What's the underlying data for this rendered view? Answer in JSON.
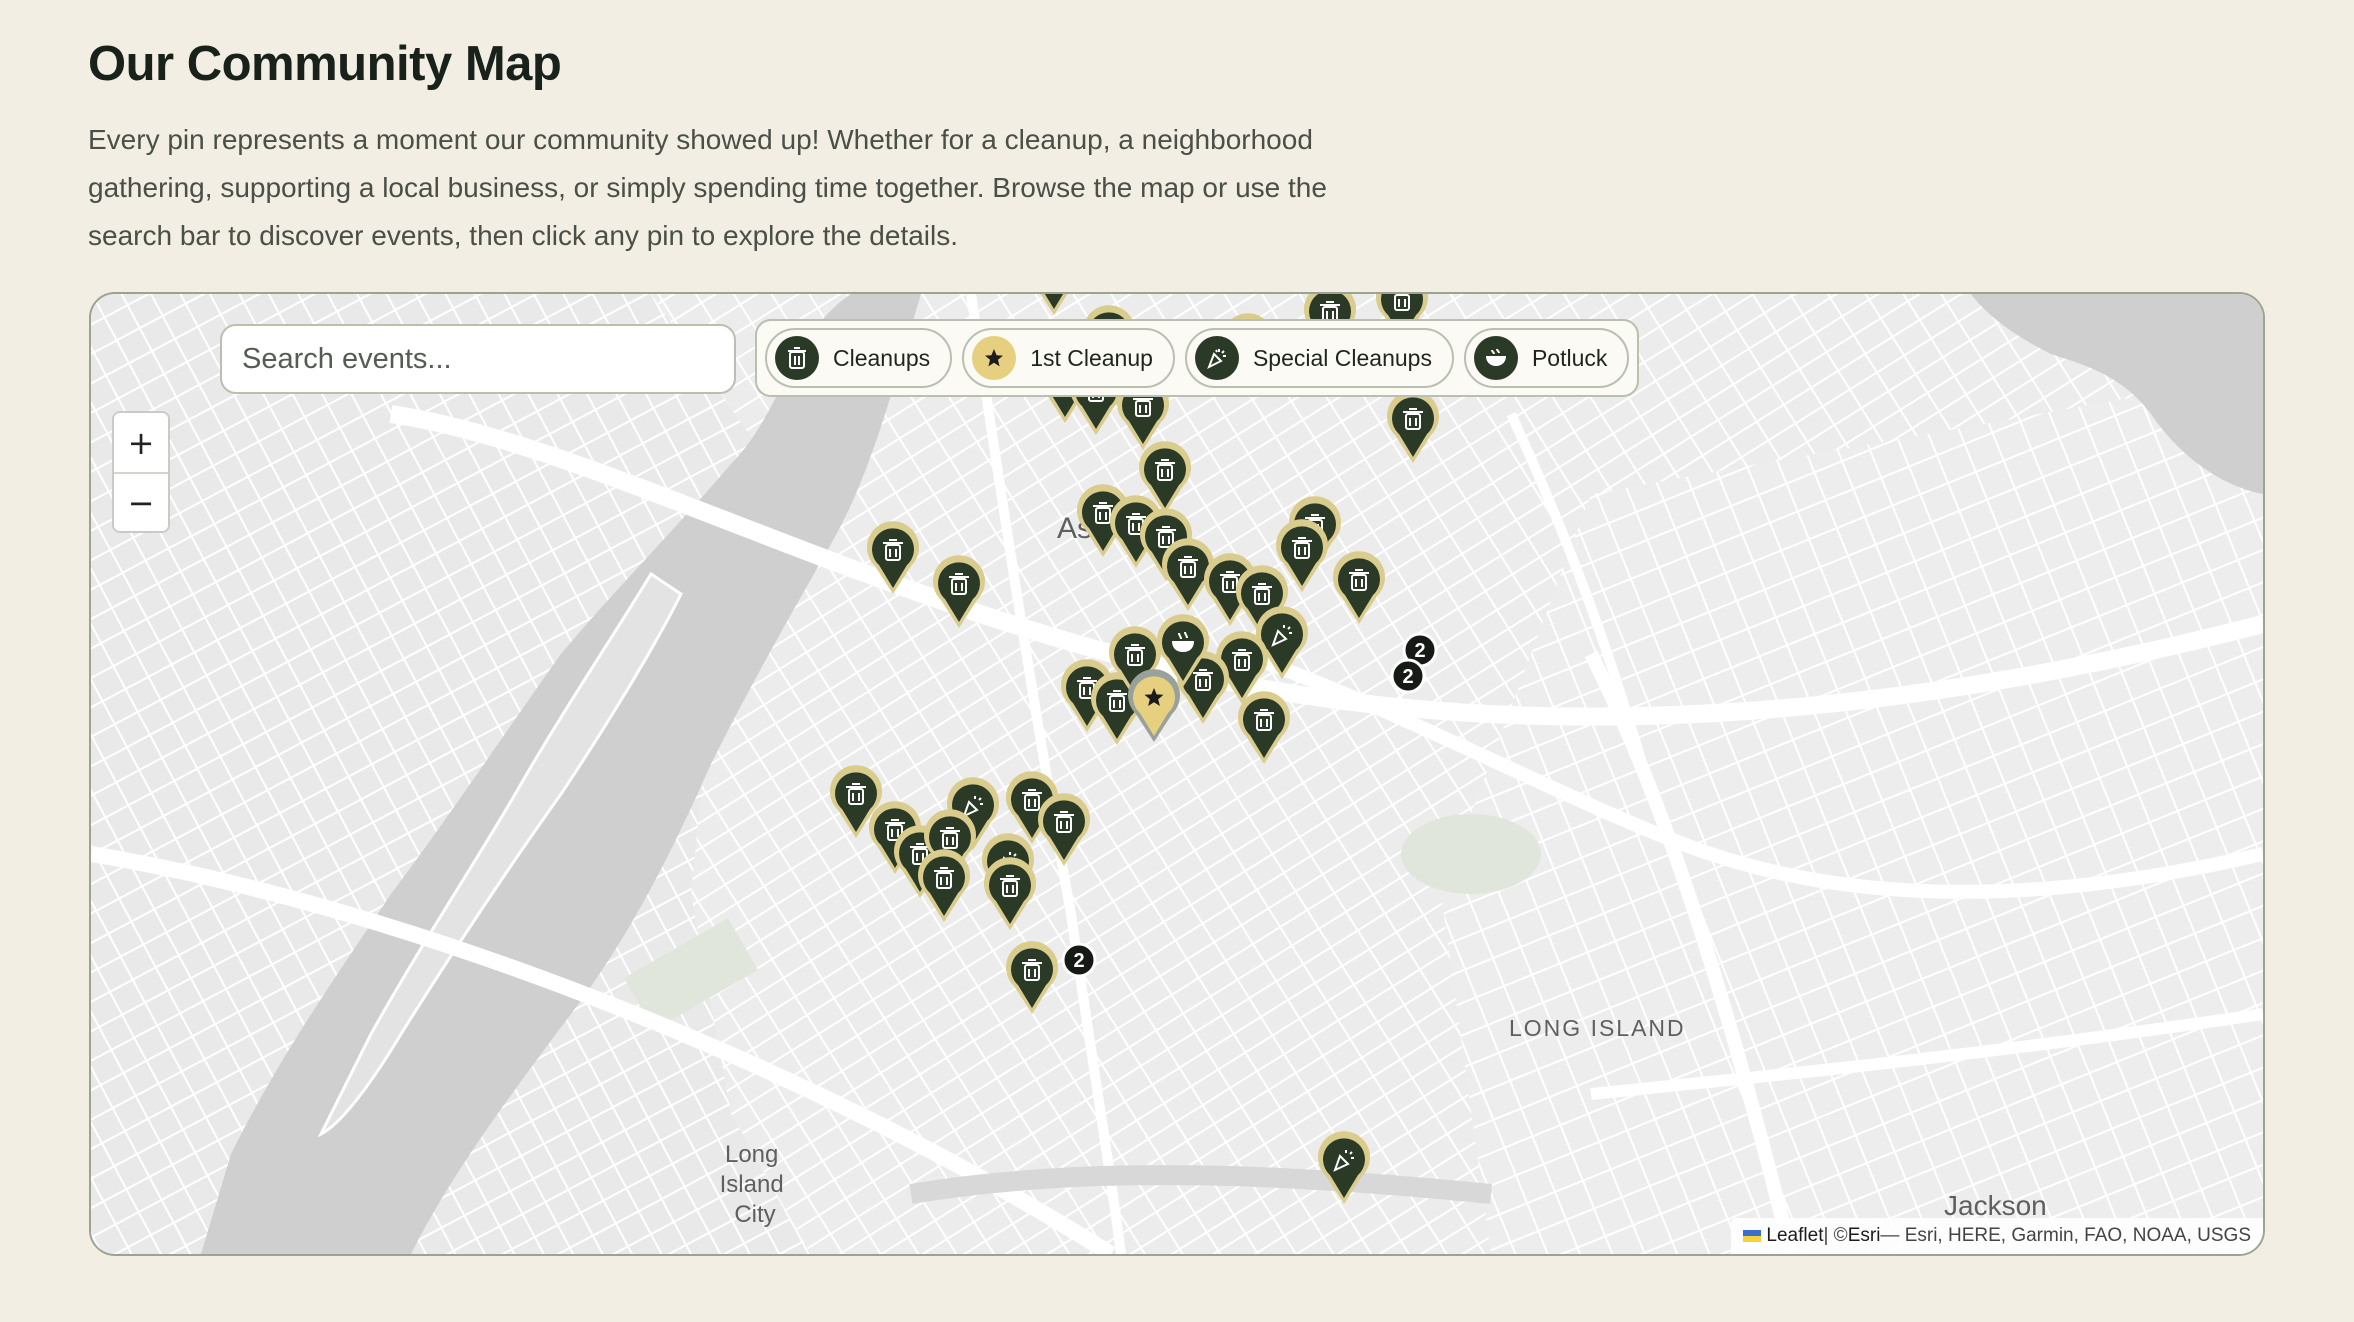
{
  "page": {
    "title": "Our Community Map",
    "description": "Every pin represents a moment our community showed up! Whether for a cleanup, a neighborhood gathering, supporting a local business, or simply spending time together. Browse the map or use the search bar to discover events, then click any pin to explore the details."
  },
  "search": {
    "placeholder": "Search events..."
  },
  "filters": [
    {
      "label": "Cleanups",
      "icon": "trash-can-icon"
    },
    {
      "label": "1st Cleanup",
      "icon": "star-icon"
    },
    {
      "label": "Special Cleanups",
      "icon": "confetti-icon"
    },
    {
      "label": "Potluck",
      "icon": "bowl-icon"
    }
  ],
  "zoom": {
    "in": "+",
    "out": "−"
  },
  "place_labels": {
    "astoria": "Astoria",
    "lic": [
      "Long",
      "Island",
      "City"
    ],
    "long_island": "LONG ISLAND",
    "jackson": "Jackson"
  },
  "attribution": {
    "leaflet": "Leaflet",
    "sep": " | © ",
    "esri": "Esri",
    "rest": " — Esri, HERE, Garmin, FAO, NOAA, USGS"
  },
  "cluster_counts": [
    "2",
    "2",
    "2"
  ],
  "colors": {
    "page_bg": "#f2eee3",
    "pin_dark": "#2b3a26",
    "pin_ring": "#d9cc8d",
    "star_pin": "#e6d07f",
    "water": "#cfcfcf"
  }
}
